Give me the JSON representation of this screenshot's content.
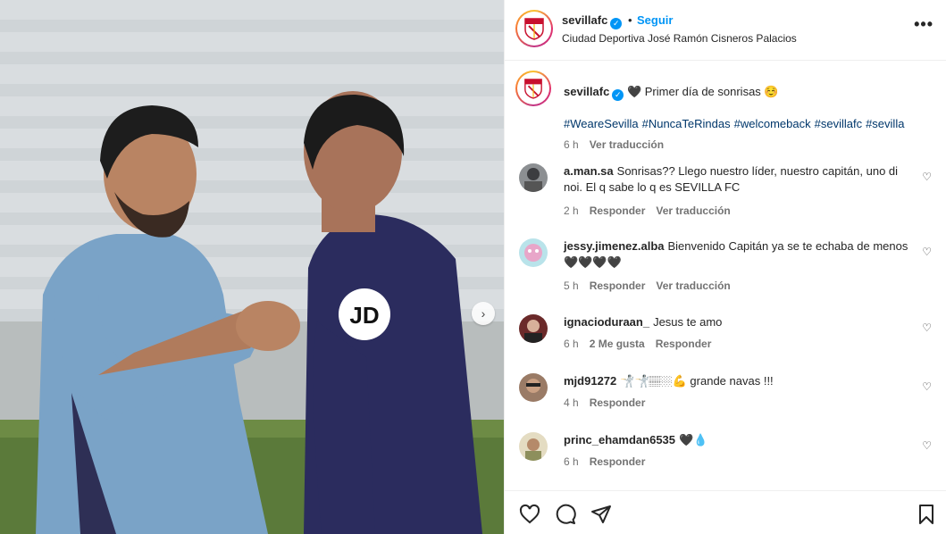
{
  "post": {
    "username": "sevillafc",
    "verified_mark": "✓",
    "dot": "•",
    "follow_label": "Seguir",
    "location": "Ciudad Deportiva José Ramón Cisneros Palacios",
    "more_label": "•••"
  },
  "caption": {
    "username": "sevillafc",
    "text": "🖤 Primer día de sonrisas ☺️",
    "hashtags": [
      "#WeareSevilla",
      "#NuncaTeRindas",
      "#welcomeback",
      "#sevillafc",
      "#sevilla"
    ],
    "time": "6 h",
    "translate": "Ver traducción"
  },
  "comments": [
    {
      "username": "a.man.sa",
      "text": "Sonrisas?? Llego nuestro líder, nuestro capitán, uno di noi. El q sabe lo q es SEVILLA FC",
      "time": "2 h",
      "actions": [
        "Responder",
        "Ver traducción"
      ]
    },
    {
      "username": "jessy.jimenez.alba",
      "text": "Bienvenido Capitán ya se te echaba de menos 🖤🖤🖤🖤",
      "time": "5 h",
      "actions": [
        "Responder",
        "Ver traducción"
      ]
    },
    {
      "username": "ignacioduraan_",
      "text": "Jesus te amo",
      "time": "6 h",
      "actions": [
        "2 Me gusta",
        "Responder"
      ]
    },
    {
      "username": "mjd91272",
      "text": "🤺🤺🏽🏼💪 grande navas !!!",
      "time": "4 h",
      "actions": [
        "Responder"
      ]
    },
    {
      "username": "princ_ehamdan6535",
      "text": "🖤💧",
      "time": "6 h",
      "actions": [
        "Responder"
      ]
    }
  ],
  "icons": {
    "like": "heart-icon",
    "comment": "comment-icon",
    "share": "share-icon",
    "save": "bookmark-icon",
    "next": "chevron-right-icon"
  },
  "colors": {
    "accent": "#0095f6",
    "hashtag": "#00376b",
    "muted": "#737373"
  },
  "next_glyph": "›",
  "heart_glyph": "♡",
  "jersey_logo": "JD"
}
